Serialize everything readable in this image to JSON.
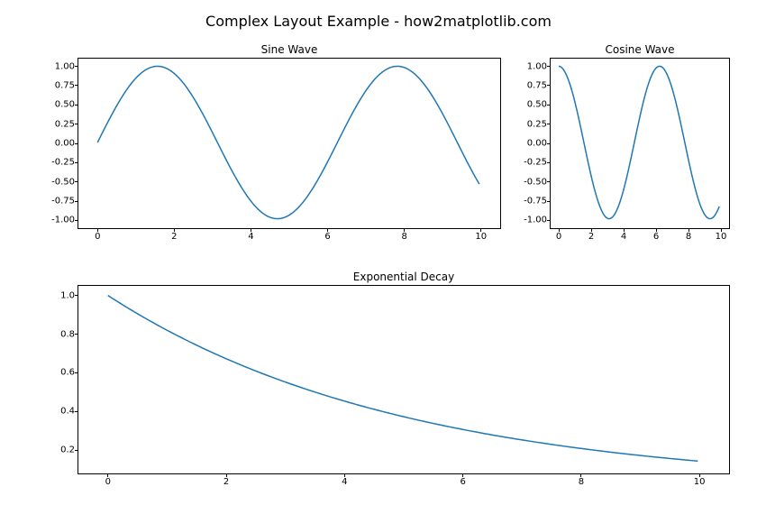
{
  "suptitle": "Complex Layout Example - how2matplotlib.com",
  "line_color": "#1f77b4",
  "chart_data": [
    {
      "type": "line",
      "title": "Sine Wave",
      "xlabel": "",
      "ylabel": "",
      "xlim": [
        -0.5,
        10.5
      ],
      "ylim": [
        -1.1,
        1.1
      ],
      "xticks": [
        0,
        2,
        4,
        6,
        8,
        10
      ],
      "yticks": [
        -1.0,
        -0.75,
        -0.5,
        -0.25,
        0.0,
        0.25,
        0.5,
        0.75,
        1.0
      ],
      "xtick_labels": [
        "0",
        "2",
        "4",
        "6",
        "8",
        "10"
      ],
      "ytick_labels": [
        "-1.00",
        "-0.75",
        "-0.50",
        "-0.25",
        "0.00",
        "0.25",
        "0.50",
        "0.75",
        "1.00"
      ],
      "function": "sin(x)",
      "x": [
        0,
        0.5,
        1,
        1.5,
        2,
        2.5,
        3,
        3.5,
        4,
        4.5,
        5,
        5.5,
        6,
        6.5,
        7,
        7.5,
        8,
        8.5,
        9,
        9.5,
        10
      ],
      "y": [
        0.0,
        0.479,
        0.841,
        0.997,
        0.909,
        0.599,
        0.141,
        -0.351,
        -0.757,
        -0.978,
        -0.959,
        -0.706,
        -0.279,
        0.215,
        0.657,
        0.938,
        0.989,
        0.798,
        0.412,
        -0.075,
        -0.544
      ]
    },
    {
      "type": "line",
      "title": "Cosine Wave",
      "xlabel": "",
      "ylabel": "",
      "xlim": [
        -0.5,
        10.5
      ],
      "ylim": [
        -1.1,
        1.1
      ],
      "xticks": [
        0,
        2,
        4,
        6,
        8,
        10
      ],
      "yticks": [
        -1.0,
        -0.75,
        -0.5,
        -0.25,
        0.0,
        0.25,
        0.5,
        0.75,
        1.0
      ],
      "xtick_labels": [
        "0",
        "2",
        "4",
        "6",
        "8",
        "10"
      ],
      "ytick_labels": [
        "-1.00",
        "-0.75",
        "-0.50",
        "-0.25",
        "0.00",
        "0.25",
        "0.50",
        "0.75",
        "1.00"
      ],
      "function": "cos(x)",
      "x": [
        0,
        0.5,
        1,
        1.5,
        2,
        2.5,
        3,
        3.5,
        4,
        4.5,
        5,
        5.5,
        6,
        6.5,
        7,
        7.5,
        8,
        8.5,
        9,
        9.5,
        10
      ],
      "y": [
        1.0,
        0.878,
        0.54,
        0.071,
        -0.416,
        -0.801,
        -0.99,
        -0.936,
        -0.654,
        -0.211,
        0.284,
        0.709,
        0.96,
        0.977,
        0.754,
        0.347,
        -0.146,
        -0.602,
        -0.911,
        -0.997,
        -0.839
      ]
    },
    {
      "type": "line",
      "title": "Exponential Decay",
      "xlabel": "",
      "ylabel": "",
      "xlim": [
        -0.5,
        10.5
      ],
      "ylim": [
        0.08,
        1.05
      ],
      "xticks": [
        0,
        2,
        4,
        6,
        8,
        10
      ],
      "yticks": [
        0.2,
        0.4,
        0.6,
        0.8,
        1.0
      ],
      "xtick_labels": [
        "0",
        "2",
        "4",
        "6",
        "8",
        "10"
      ],
      "ytick_labels": [
        "0.2",
        "0.4",
        "0.6",
        "0.8",
        "1.0"
      ],
      "function": "exp(-x/5)",
      "x": [
        0,
        0.5,
        1,
        1.5,
        2,
        2.5,
        3,
        3.5,
        4,
        4.5,
        5,
        5.5,
        6,
        6.5,
        7,
        7.5,
        8,
        8.5,
        9,
        9.5,
        10
      ],
      "y": [
        1.0,
        0.905,
        0.819,
        0.741,
        0.67,
        0.607,
        0.549,
        0.497,
        0.449,
        0.407,
        0.368,
        0.333,
        0.301,
        0.273,
        0.247,
        0.223,
        0.202,
        0.183,
        0.165,
        0.15,
        0.135
      ]
    }
  ]
}
